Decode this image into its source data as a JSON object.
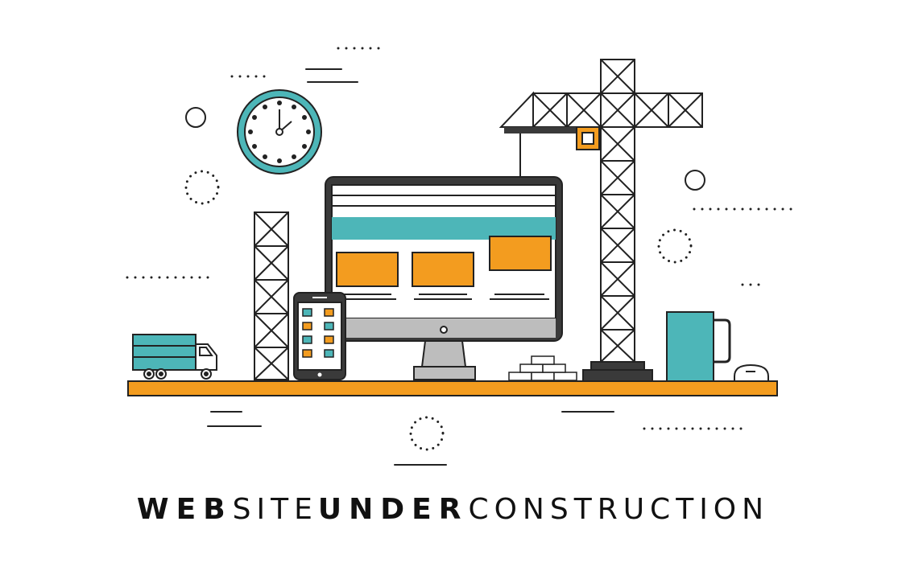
{
  "caption": {
    "word1": "WEB",
    "word2": "SITE",
    "word3": "UNDER",
    "word4": "CONSTRUCTION"
  },
  "colors": {
    "teal": "#4db6b8",
    "orange": "#f39c1f",
    "ink": "#222222",
    "screen_bezel": "#3a3a3a",
    "stand": "#bdbdbd"
  },
  "icons": [
    "clock-icon",
    "crane-icon",
    "monitor-icon",
    "tablet-icon",
    "truck-icon",
    "mug-icon",
    "mouse-icon",
    "bricks-icon",
    "scaffold-tower-icon"
  ]
}
